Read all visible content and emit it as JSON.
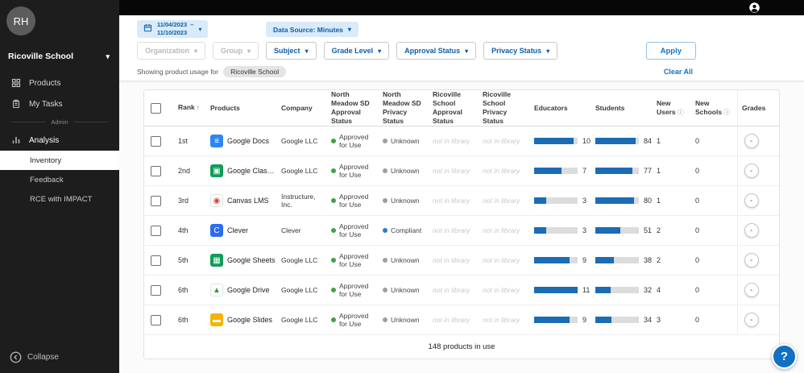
{
  "topbar": {
    "account_icon": "account"
  },
  "sidebar": {
    "avatar_initials": "RH",
    "org_name": "Ricoville School",
    "items": [
      {
        "label": "Products"
      },
      {
        "label": "My Tasks"
      }
    ],
    "section_label": "Admin",
    "analysis_label": "Analysis",
    "analysis_children": [
      {
        "label": "Inventory"
      },
      {
        "label": "Feedback"
      },
      {
        "label": "RCE with IMPACT"
      }
    ],
    "collapse_label": "Collapse"
  },
  "filters": {
    "date_start": "11/04/2023",
    "date_separator": "–",
    "date_end": "11/10/2023",
    "data_source": "Data Source: Minutes",
    "dropdowns": [
      {
        "label": "Organization",
        "enabled": false
      },
      {
        "label": "Group",
        "enabled": false
      },
      {
        "label": "Subject",
        "enabled": true
      },
      {
        "label": "Grade Level",
        "enabled": true
      },
      {
        "label": "Approval Status",
        "enabled": true
      },
      {
        "label": "Privacy Status",
        "enabled": true
      }
    ],
    "apply_label": "Apply",
    "showing_label": "Showing product usage for",
    "showing_chip": "Ricoville School",
    "clear_all_label": "Clear All"
  },
  "table": {
    "headers": {
      "rank": "Rank",
      "sort_arrow": "↑",
      "products": "Products",
      "company": "Company",
      "nm_approval": "North Meadow SD Approval Status",
      "nm_privacy": "North Meadow SD Privacy Status",
      "rs_approval": "Ricoville School Approval Status",
      "rs_privacy": "Ricoville School Privacy Status",
      "educators": "Educators",
      "students": "Students",
      "new_users": "New Users",
      "new_schools": "New Schools",
      "info_icon": "ⓘ",
      "grades": "Grades"
    },
    "educators_max": 11,
    "students_max": 90,
    "rows": [
      {
        "rank": "1st",
        "product": "Google Docs",
        "company": "Google LLC",
        "nm_approval": "Approved for Use",
        "nm_privacy": "Unknown",
        "nm_privacy_dot": "#9e9e9e",
        "rs_approval": "not in library",
        "rs_privacy": "not in library",
        "educators": 10,
        "students": 84,
        "new_users": 1,
        "new_schools": 0,
        "grades": "-",
        "icon": {
          "name": "google-docs-icon",
          "bg": "#2b87f3",
          "fg": "#ffffff",
          "glyph": "≡"
        }
      },
      {
        "rank": "2nd",
        "product": "Google Classro...",
        "company": "Google LLC",
        "nm_approval": "Approved for Use",
        "nm_privacy": "Unknown",
        "nm_privacy_dot": "#9e9e9e",
        "rs_approval": "not in library",
        "rs_privacy": "not in library",
        "educators": 7,
        "students": 77,
        "new_users": 1,
        "new_schools": 0,
        "grades": "-",
        "icon": {
          "name": "google-classroom-icon",
          "bg": "#0f9d58",
          "fg": "#ffffff",
          "glyph": "▣"
        }
      },
      {
        "rank": "3rd",
        "product": "Canvas LMS",
        "company": "Instructure, Inc.",
        "nm_approval": "Approved for Use",
        "nm_privacy": "Unknown",
        "nm_privacy_dot": "#9e9e9e",
        "rs_approval": "not in library",
        "rs_privacy": "not in library",
        "educators": 3,
        "students": 80,
        "new_users": 1,
        "new_schools": 0,
        "grades": "-",
        "icon": {
          "name": "canvas-lms-icon",
          "bg": "#ffffff",
          "fg": "#e03c31",
          "glyph": "◉",
          "border": true
        }
      },
      {
        "rank": "4th",
        "product": "Clever",
        "company": "Clever",
        "nm_approval": "Approved for Use",
        "nm_privacy": "Compliant",
        "nm_privacy_dot": "#2e7cc4",
        "rs_approval": "not in library",
        "rs_privacy": "not in library",
        "educators": 3,
        "students": 51,
        "new_users": 2,
        "new_schools": 0,
        "grades": "-",
        "icon": {
          "name": "clever-icon",
          "bg": "#2d6cf0",
          "fg": "#ffffff",
          "glyph": "C"
        }
      },
      {
        "rank": "5th",
        "product": "Google Sheets",
        "company": "Google LLC",
        "nm_approval": "Approved for Use",
        "nm_privacy": "Unknown",
        "nm_privacy_dot": "#9e9e9e",
        "rs_approval": "not in library",
        "rs_privacy": "not in library",
        "educators": 9,
        "students": 38,
        "new_users": 2,
        "new_schools": 0,
        "grades": "-",
        "icon": {
          "name": "google-sheets-icon",
          "bg": "#0f9d58",
          "fg": "#ffffff",
          "glyph": "▦"
        }
      },
      {
        "rank": "6th",
        "product": "Google Drive",
        "company": "Google LLC",
        "nm_approval": "Approved for Use",
        "nm_privacy": "Unknown",
        "nm_privacy_dot": "#9e9e9e",
        "rs_approval": "not in library",
        "rs_privacy": "not in library",
        "educators": 11,
        "students": 32,
        "new_users": 4,
        "new_schools": 0,
        "grades": "-",
        "icon": {
          "name": "google-drive-icon",
          "bg": "#ffffff",
          "fg": "#2ea04f",
          "glyph": "▲",
          "border": true
        }
      },
      {
        "rank": "6th",
        "product": "Google Slides",
        "company": "Google LLC",
        "nm_approval": "Approved for Use",
        "nm_privacy": "Unknown",
        "nm_privacy_dot": "#9e9e9e",
        "rs_approval": "not in library",
        "rs_privacy": "not in library",
        "educators": 9,
        "students": 34,
        "new_users": 3,
        "new_schools": 0,
        "grades": "-",
        "icon": {
          "name": "google-slides-icon",
          "bg": "#f5b400",
          "fg": "#ffffff",
          "glyph": "▬"
        }
      }
    ],
    "footer": "148 products in use"
  },
  "help": {
    "label": "?"
  },
  "colors": {
    "accent_blue": "#1273bf",
    "bar_fill": "#1b6cb5",
    "bar_bg": "#dcdcdc",
    "approval_dot": "#43a047",
    "unknown_dot": "#9e9e9e",
    "compliant_dot": "#2e7cc4",
    "chip_bg": "#d9eaf8",
    "sidebar_bg": "#1d1d1d"
  }
}
